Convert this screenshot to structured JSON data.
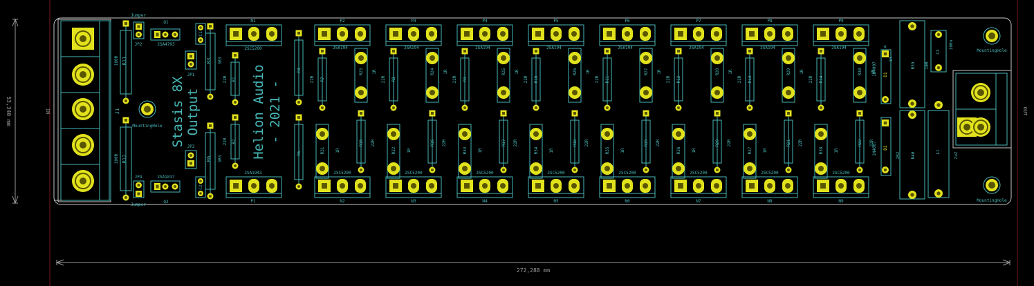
{
  "colors": {
    "background": "#000000",
    "outline": "#c8c8c8",
    "silk": "#48b8b8",
    "fab": "#7e8a9a",
    "pad": "#e2e21c",
    "hole": "#5a5600",
    "dim": "#9a9a9a",
    "keepout": "#7a1818"
  },
  "board": {
    "title_line1": "Stasis 8X",
    "title_line2": "Output",
    "maker_line1": "Helion Audio",
    "maker_line2": "- 2021 -",
    "in_label": "IN",
    "out_label": "OUT",
    "dim_width": "272,288 mm",
    "dim_height": "53,340 mm"
  },
  "input": {
    "connector": "J1",
    "mount_label": "MountingHole",
    "r_top": "R11",
    "r_top_val": "100R",
    "r_bot": "R12",
    "r_bot_val": "100R",
    "jp_top": "JP2",
    "jp_bot": "JP4",
    "jumper_label": "Jumper",
    "q1": "Q1",
    "q1_part": "2SA4793",
    "q2": "Q2",
    "q2_part": "2SA1837",
    "jp1": "JP1",
    "jp3": "JP3",
    "c1": "C1",
    "c2": "C2",
    "r3": "R3",
    "r3_val": "3R3",
    "r6": "R6",
    "r6_val": "3R3"
  },
  "driver": {
    "n1": "N1",
    "n1_part": "2SC5200",
    "p1": "P1",
    "p1_part": "2SA1943",
    "r1": "R1",
    "r1_val": "22R",
    "r2": "R2",
    "r2_val": "22R",
    "r4": "R4",
    "r5": "R5"
  },
  "output_stages": [
    {
      "p": "P2",
      "n": "N2",
      "gate_top": "R7",
      "emit_top": "R23",
      "emit_bot": "R31",
      "gate_bot": "R15"
    },
    {
      "p": "P3",
      "n": "N3",
      "gate_top": "R8",
      "emit_top": "R24",
      "emit_bot": "R32",
      "gate_bot": "R16"
    },
    {
      "p": "P4",
      "n": "N4",
      "gate_top": "R9",
      "emit_top": "R25",
      "emit_bot": "R33",
      "gate_bot": "R17"
    },
    {
      "p": "P5",
      "n": "N5",
      "gate_top": "R10",
      "emit_top": "R26",
      "emit_bot": "R34",
      "gate_bot": "R18"
    },
    {
      "p": "P6",
      "n": "N6",
      "gate_top": "R11",
      "emit_top": "R27",
      "emit_bot": "R35",
      "gate_bot": "R19"
    },
    {
      "p": "P7",
      "n": "N7",
      "gate_top": "R12",
      "emit_top": "R28",
      "emit_bot": "R36",
      "gate_bot": "R20"
    },
    {
      "p": "P8",
      "n": "N8",
      "gate_top": "R13",
      "emit_top": "R29",
      "emit_bot": "R37",
      "gate_bot": "R21"
    },
    {
      "p": "P9",
      "n": "N9",
      "gate_top": "R14",
      "emit_top": "R30",
      "emit_bot": "R38",
      "gate_bot": "R22"
    }
  ],
  "stage_values": {
    "p_part": "2SA1943",
    "p_part_short": "2SA194",
    "n_part": "2SC5200",
    "gate": "22R",
    "emitter": "1R"
  },
  "output_section": {
    "d1": "D1",
    "d2": "D2",
    "diode": "1N4007",
    "r39": "R39",
    "r40": "R40",
    "r40_val": "2R2",
    "r39_val": "10R",
    "c3": "C3",
    "c3_val": "100n",
    "l1": "L1",
    "l1_val": "2u2",
    "mount_top": "MountingHole",
    "mount_bot": "MountingHole",
    "r_mid_val": "1R",
    "k_label": "K"
  }
}
